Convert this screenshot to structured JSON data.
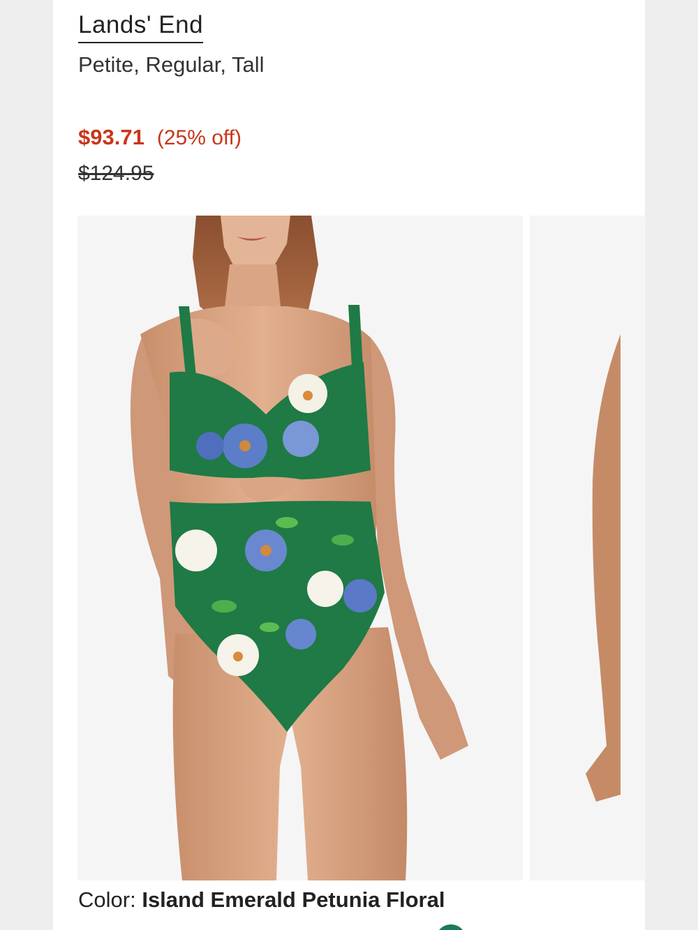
{
  "product": {
    "brand": "Lands' End",
    "sizes": "Petite, Regular, Tall",
    "price": {
      "sale": "$93.71",
      "discount": "(25% off)",
      "original": "$124.95"
    },
    "color": {
      "label": "Color:",
      "value": "Island Emerald Petunia Floral"
    }
  },
  "colors": {
    "sale_price": "#c8361a",
    "swimsuit_green": "#1f7a45",
    "photo_background": "#f5f5f5"
  }
}
